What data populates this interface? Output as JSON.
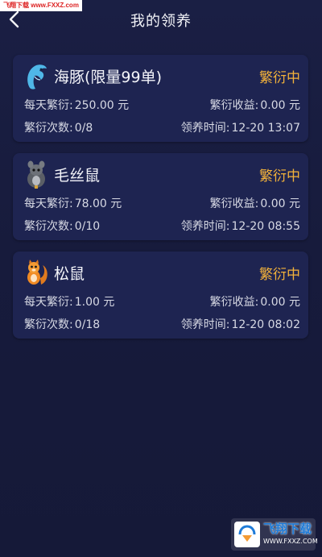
{
  "watermark_top": "飞翔下载 www.FXXZ.com",
  "header": {
    "title": "我的领养"
  },
  "cards": [
    {
      "name": "海豚(限量99单)",
      "status": "繁衍中",
      "daily_label": "每天繁衍:",
      "daily_value": "250.00 元",
      "income_label": "繁衍收益:",
      "income_value": "0.00 元",
      "count_label": "繁衍次数:",
      "count_value": "0/8",
      "time_label": "领养时间:",
      "time_value": "12-20 13:07",
      "icon": "dolphin-icon"
    },
    {
      "name": "毛丝鼠",
      "status": "繁衍中",
      "daily_label": "每天繁衍:",
      "daily_value": "78.00 元",
      "income_label": "繁衍收益:",
      "income_value": "0.00 元",
      "count_label": "繁衍次数:",
      "count_value": "0/10",
      "time_label": "领养时间:",
      "time_value": "12-20 08:55",
      "icon": "chinchilla-icon"
    },
    {
      "name": "松鼠",
      "status": "繁衍中",
      "daily_label": "每天繁衍:",
      "daily_value": "1.00 元",
      "income_label": "繁衍收益:",
      "income_value": "0.00 元",
      "count_label": "繁衍次数:",
      "count_value": "0/18",
      "time_label": "领养时间:",
      "time_value": "12-20 08:02",
      "icon": "squirrel-icon"
    }
  ],
  "watermark_bottom": {
    "title": "飞翔下载",
    "url": "WWW.FXXZ.COM"
  },
  "colors": {
    "background": "#171b3c",
    "card": "#1e2451",
    "status": "#f3b23a"
  }
}
